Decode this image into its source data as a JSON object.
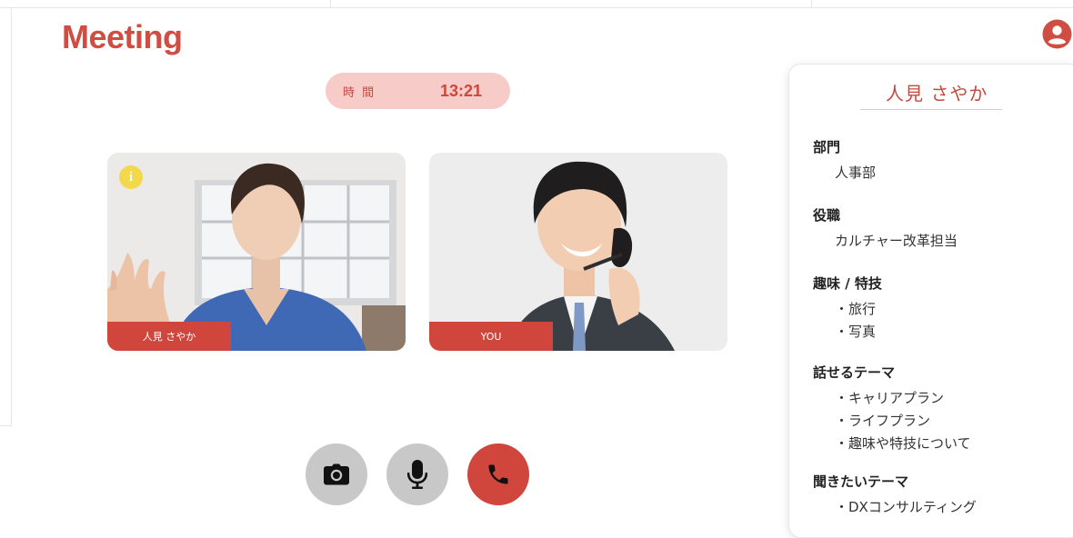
{
  "app": {
    "title": "Meeting",
    "user_icon": "user-circle-icon",
    "accent_color": "#cf4d42"
  },
  "timer": {
    "label": "時 間",
    "value": "13:21"
  },
  "videos": [
    {
      "name": "人見 さやか",
      "has_info_badge": true,
      "info_glyph": "i"
    },
    {
      "name": "YOU"
    }
  ],
  "controls": [
    {
      "icon": "camera-icon",
      "style": "gray"
    },
    {
      "icon": "microphone-icon",
      "style": "gray"
    },
    {
      "icon": "phone-hangup-icon",
      "style": "red"
    }
  ],
  "profile": {
    "name": "人見 さやか",
    "sections": [
      {
        "heading": "部門",
        "items": [
          "人事部"
        ]
      },
      {
        "heading": "役職",
        "items": [
          "カルチャー改革担当"
        ]
      },
      {
        "heading": "趣味 / 特技",
        "items": [
          "・旅行",
          "・写真"
        ]
      },
      {
        "heading": "話せるテーマ",
        "items": [
          "・キャリアプラン",
          "・ライフプラン",
          "・趣味や特技について"
        ]
      },
      {
        "heading": "聞きたいテーマ",
        "items": [
          "・DXコンサルティング"
        ]
      }
    ]
  }
}
